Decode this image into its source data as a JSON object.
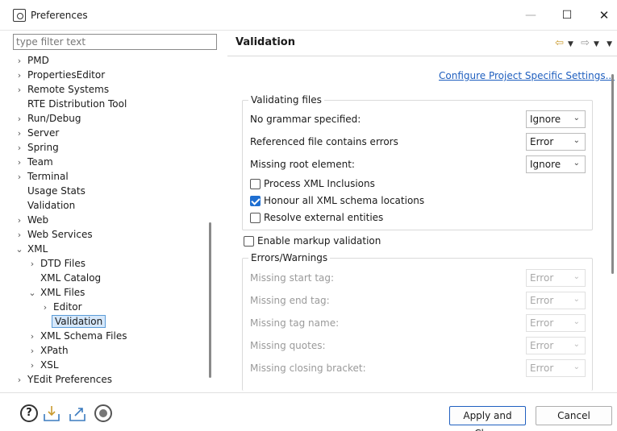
{
  "window": {
    "title": "Preferences",
    "minimize": "—",
    "maximize": "☐",
    "close": "✕"
  },
  "filter": {
    "placeholder": "type filter text"
  },
  "tree": [
    {
      "label": "PMD",
      "arrow": "›"
    },
    {
      "label": "PropertiesEditor",
      "arrow": "›"
    },
    {
      "label": "Remote Systems",
      "arrow": "›"
    },
    {
      "label": "RTE Distribution Tool",
      "arrow": ""
    },
    {
      "label": "Run/Debug",
      "arrow": "›"
    },
    {
      "label": "Server",
      "arrow": "›"
    },
    {
      "label": "Spring",
      "arrow": "›"
    },
    {
      "label": "Team",
      "arrow": "›"
    },
    {
      "label": "Terminal",
      "arrow": "›"
    },
    {
      "label": "Usage Stats",
      "arrow": ""
    },
    {
      "label": "Validation",
      "arrow": ""
    },
    {
      "label": "Web",
      "arrow": "›"
    },
    {
      "label": "Web Services",
      "arrow": "›"
    },
    {
      "label": "XML",
      "arrow": "⌄"
    },
    {
      "label": "DTD Files",
      "arrow": "›"
    },
    {
      "label": "XML Catalog",
      "arrow": ""
    },
    {
      "label": "XML Files",
      "arrow": "⌄"
    },
    {
      "label": "Editor",
      "arrow": "›"
    },
    {
      "label": "Validation",
      "arrow": ""
    },
    {
      "label": "XML Schema Files",
      "arrow": "›"
    },
    {
      "label": "XPath",
      "arrow": "›"
    },
    {
      "label": "XSL",
      "arrow": "›"
    },
    {
      "label": "YEdit Preferences",
      "arrow": "›"
    }
  ],
  "page": {
    "title": "Validation",
    "config_link": "Configure Project Specific Settings...",
    "validating_files": {
      "title": "Validating files",
      "rows": [
        {
          "label": "No grammar specified:",
          "value": "Ignore"
        },
        {
          "label": "Referenced file contains errors",
          "value": "Error"
        },
        {
          "label": "Missing root element:",
          "value": "Ignore"
        }
      ],
      "checkboxes": [
        {
          "label": "Process XML Inclusions",
          "checked": false
        },
        {
          "label": "Honour all XML schema locations",
          "checked": true
        },
        {
          "label": "Resolve external entities",
          "checked": false
        }
      ]
    },
    "enable_markup": {
      "label": "Enable markup validation",
      "checked": false
    },
    "errors_warnings": {
      "title": "Errors/Warnings",
      "rows": [
        {
          "label": "Missing start tag:",
          "value": "Error"
        },
        {
          "label": "Missing end tag:",
          "value": "Error"
        },
        {
          "label": "Missing tag name:",
          "value": "Error"
        },
        {
          "label": "Missing quotes:",
          "value": "Error"
        },
        {
          "label": "Missing closing bracket:",
          "value": "Error"
        }
      ]
    }
  },
  "footer": {
    "apply_close": "Apply and Close",
    "cancel": "Cancel",
    "help": "?"
  },
  "colors": {
    "accent": "#1f5fbf",
    "checkbox": "#1f6fd1",
    "nav_arrow": "#c99a2e"
  }
}
